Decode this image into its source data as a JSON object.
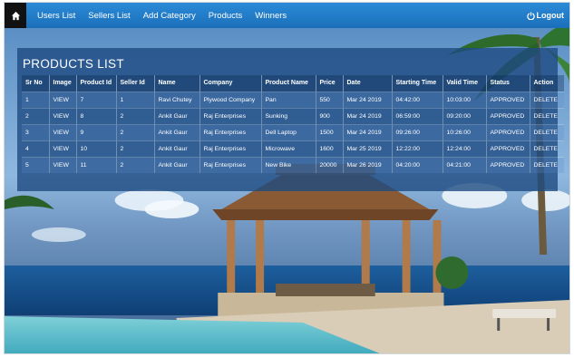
{
  "nav": {
    "items": [
      "Users List",
      "Sellers List",
      "Add Category",
      "Products",
      "Winners"
    ],
    "logout": "Logout"
  },
  "panel": {
    "title": "PRODUCTS LIST"
  },
  "table": {
    "headers": [
      "Sr No",
      "Image",
      "Product Id",
      "Seller Id",
      "Name",
      "Company",
      "Product Name",
      "Price",
      "Date",
      "Starting Time",
      "Valid Time",
      "Status",
      "Action"
    ],
    "rows": [
      [
        "1",
        "VIEW",
        "7",
        "1",
        "Ravi Chutey",
        "Plywood Company",
        "Pan",
        "550",
        "Mar 24 2019",
        "04:42:00",
        "10:03:00",
        "APPROVED",
        "DELETE"
      ],
      [
        "2",
        "VIEW",
        "8",
        "2",
        "Ankit Gaur",
        "Raj Enterprises",
        "Sunking",
        "900",
        "Mar 24 2019",
        "06:59:00",
        "09:20:00",
        "APPROVED",
        "DELETE"
      ],
      [
        "3",
        "VIEW",
        "9",
        "2",
        "Ankit Gaur",
        "Raj Enterprises",
        "Dell Laptop",
        "1500",
        "Mar 24 2019",
        "09:26:00",
        "10:26:00",
        "APPROVED",
        "DELETE"
      ],
      [
        "4",
        "VIEW",
        "10",
        "2",
        "Ankit Gaur",
        "Raj Enterprises",
        "Microwave",
        "1600",
        "Mar 25 2019",
        "12:22:00",
        "12:24:00",
        "APPROVED",
        "DELETE"
      ],
      [
        "5",
        "VIEW",
        "11",
        "2",
        "Ankit Gaur",
        "Raj Enterprises",
        "New Bike",
        "20000",
        "Mar 26 2019",
        "04:20:00",
        "04:21:00",
        "APPROVED",
        "DELETE"
      ]
    ]
  },
  "icons": {
    "home": "home-icon",
    "logout": "power-icon"
  },
  "colors": {
    "navbar": "#1b6fb9",
    "panel": "#1e4b82"
  }
}
